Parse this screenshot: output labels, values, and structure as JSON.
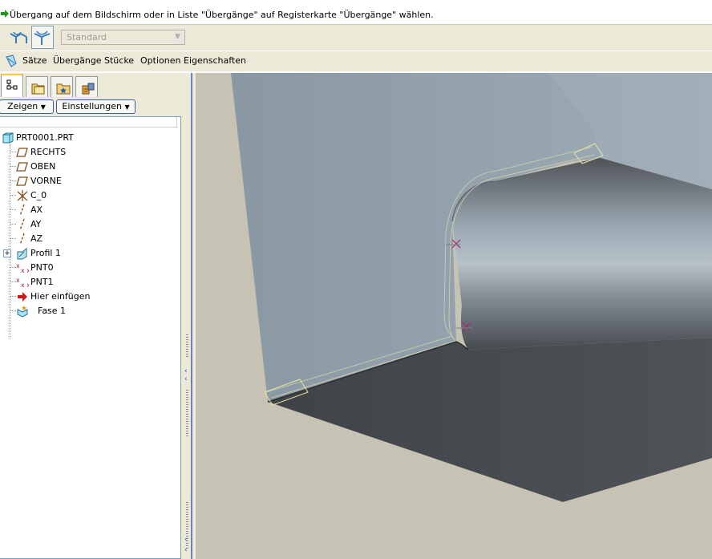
{
  "message": {
    "text": "Übergang auf dem Bildschirm oder in Liste \"Übergänge\" auf Registerkarte \"Übergänge\" wählen.",
    "icon": "green-arrow-icon"
  },
  "dashboard": {
    "set_select_icon": "round-set-icon",
    "transition_icon": "round-transition-icon",
    "combo_value": "Standard"
  },
  "menu": {
    "icon": "round-feature-icon",
    "items": [
      "Sätze",
      "Übergänge",
      "Stücke",
      "Optionen",
      "Eigenschaften"
    ]
  },
  "tabs": [
    "model-tree-icon",
    "folder-browser-icon",
    "favorites-icon",
    "connections-icon"
  ],
  "tree_buttons": {
    "show": "Zeigen",
    "settings": "Einstellungen"
  },
  "tree": {
    "root": "PRT0001.PRT",
    "items": [
      {
        "label": "RECHTS",
        "icon": "datum-plane-icon"
      },
      {
        "label": "OBEN",
        "icon": "datum-plane-icon"
      },
      {
        "label": "VORNE",
        "icon": "datum-plane-icon"
      },
      {
        "label": "C_0",
        "icon": "coordinate-system-icon"
      },
      {
        "label": "AX",
        "icon": "datum-axis-icon"
      },
      {
        "label": "AY",
        "icon": "datum-axis-icon"
      },
      {
        "label": "AZ",
        "icon": "datum-axis-icon"
      },
      {
        "label": "Profil 1",
        "icon": "sketch-icon"
      },
      {
        "label": "PNT0",
        "icon": "datum-point-icon"
      },
      {
        "label": "PNT1",
        "icon": "datum-point-icon"
      },
      {
        "label": "Hier einfügen",
        "icon": "insert-here-arrow-icon"
      },
      {
        "label": "Fase 1",
        "icon": "chamfer-icon"
      }
    ]
  },
  "colors": {
    "background": "#ece9d8",
    "viewport": "#c6c2b4",
    "wall": "#93a2ae",
    "floor": "#484b4f",
    "accent": "#ffc83c"
  }
}
